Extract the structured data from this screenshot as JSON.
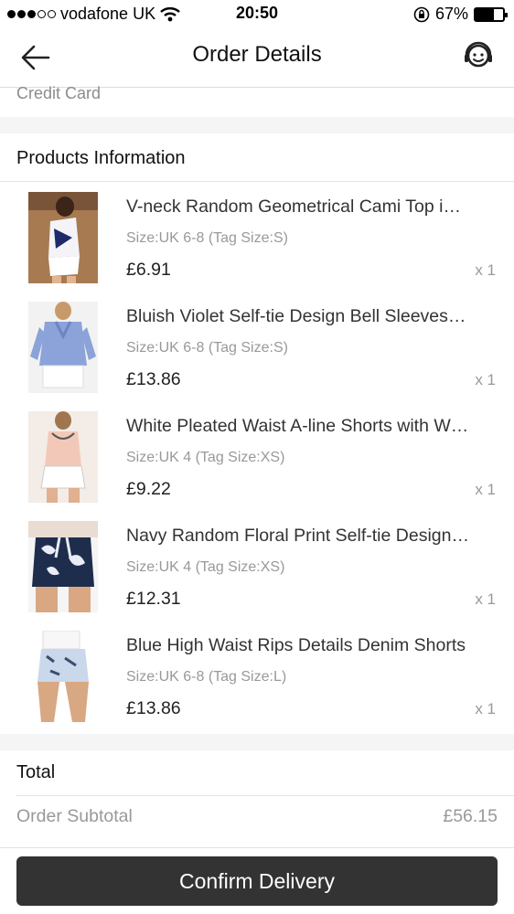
{
  "status_bar": {
    "carrier": "vodafone UK",
    "time": "20:50",
    "battery_percent": "67%",
    "battery_level": 0.67,
    "signal_bars_on": 3,
    "signal_bars_total": 5
  },
  "nav": {
    "title": "Order Details",
    "back_icon": "arrow-left-icon",
    "support_icon": "customer-service-icon"
  },
  "payment": {
    "method": "Credit Card"
  },
  "products_section": {
    "title": "Products Information",
    "items": [
      {
        "name": "V-neck Random Geometrical Cami Top i…",
        "size": "Size:UK 6-8 (Tag Size:S)",
        "price": "£6.91",
        "qty": "x 1"
      },
      {
        "name": "Bluish Violet Self-tie Design Bell Sleeves…",
        "size": "Size:UK 6-8 (Tag Size:S)",
        "price": "£13.86",
        "qty": "x 1"
      },
      {
        "name": "White Pleated Waist A-line Shorts with W…",
        "size": "Size:UK 4 (Tag Size:XS)",
        "price": "£9.22",
        "qty": "x 1"
      },
      {
        "name": "Navy Random Floral Print Self-tie Design…",
        "size": "Size:UK 4 (Tag Size:XS)",
        "price": "£12.31",
        "qty": "x 1"
      },
      {
        "name": "Blue High Waist Rips Details Denim Shorts",
        "size": "Size:UK 6-8 (Tag Size:L)",
        "price": "£13.86",
        "qty": "x 1"
      }
    ]
  },
  "total_section": {
    "title": "Total",
    "subtotal_label": "Order Subtotal",
    "subtotal_value": "£56.15"
  },
  "actions": {
    "confirm_label": "Confirm Delivery"
  },
  "colors": {
    "button_bg": "#333333",
    "muted_text": "#999999",
    "divider": "#e3e3e3"
  }
}
